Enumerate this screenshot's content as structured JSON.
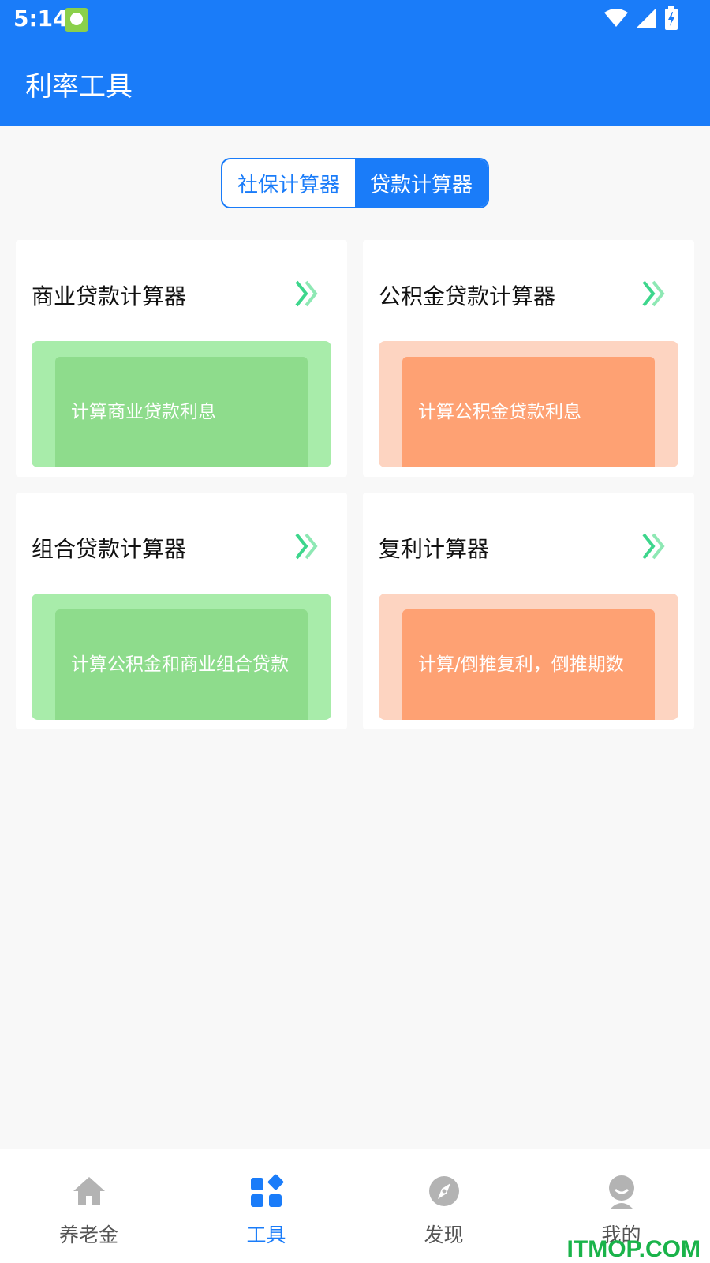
{
  "status_bar": {
    "time": "5:14"
  },
  "header": {
    "title": "利率工具"
  },
  "segmented": {
    "items": [
      {
        "label": "社保计算器",
        "active": false
      },
      {
        "label": "贷款计算器",
        "active": true
      }
    ]
  },
  "cards": [
    {
      "title": "商业贷款计算器",
      "desc": "计算商业贷款利息",
      "theme": "green"
    },
    {
      "title": "公积金贷款计算器",
      "desc": "计算公积金贷款利息",
      "theme": "orange"
    },
    {
      "title": "组合贷款计算器",
      "desc": "计算公积金和商业组合贷款",
      "theme": "green"
    },
    {
      "title": "复利计算器",
      "desc": "计算/倒推复利，倒推期数",
      "theme": "orange"
    }
  ],
  "tabbar": {
    "items": [
      {
        "label": "养老金",
        "icon": "home-icon",
        "active": false
      },
      {
        "label": "工具",
        "icon": "tools-icon",
        "active": true
      },
      {
        "label": "发现",
        "icon": "compass-icon",
        "active": false
      },
      {
        "label": "我的",
        "icon": "profile-icon",
        "active": false
      }
    ]
  },
  "watermark": "ITMOP.COM",
  "colors": {
    "primary": "#1a7cf9",
    "green_outer": "#a8ecaa",
    "green_inner": "#8edc8c",
    "orange_outer": "#fdd4c1",
    "orange_inner": "#fea173",
    "chevron": "#3dd68c"
  }
}
